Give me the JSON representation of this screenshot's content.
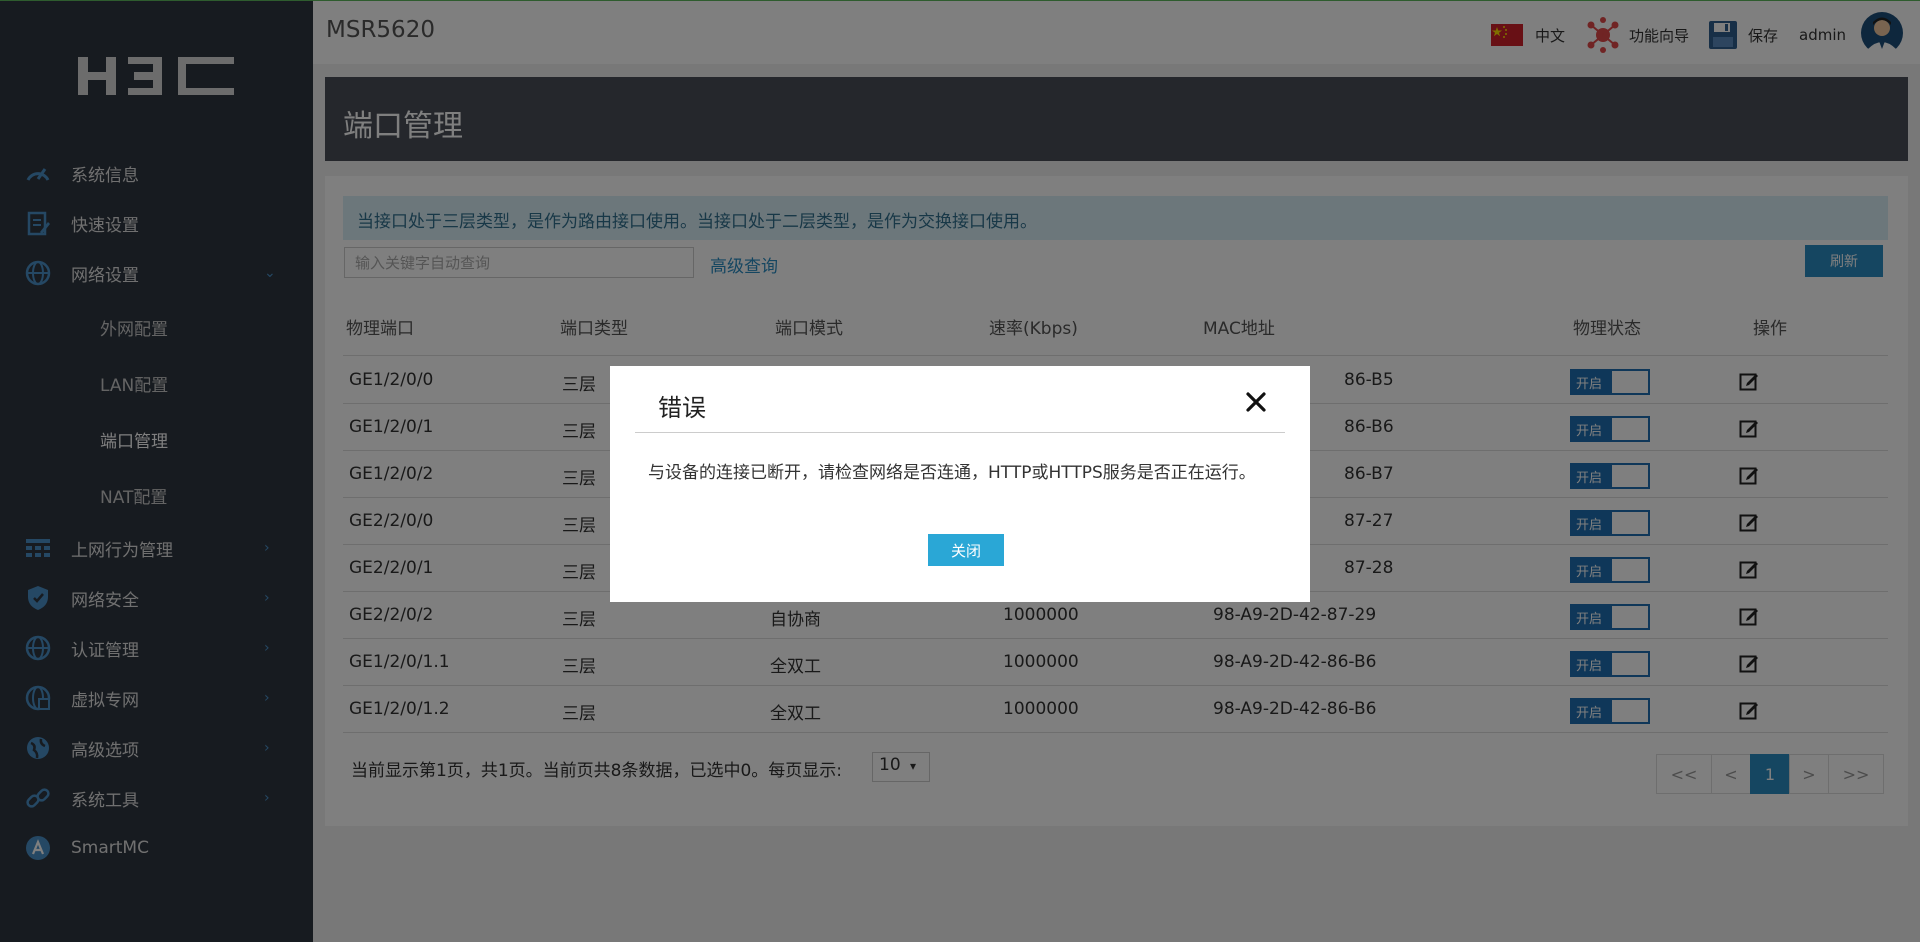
{
  "header": {
    "device_name": "MSR5620",
    "language_label": "中文",
    "wizard_label": "功能向导",
    "save_label": "保存",
    "user_name": "admin"
  },
  "sidebar": {
    "logo_text": "H3C",
    "items": [
      {
        "label": "系统信息",
        "icon": "speedometer-icon",
        "expanded": false
      },
      {
        "label": "快速设置",
        "icon": "clipboard-icon",
        "expanded": false
      },
      {
        "label": "网络设置",
        "icon": "globe-icon",
        "expanded": true,
        "chevron": "⌄"
      },
      {
        "label": "上网行为管理",
        "icon": "grid-icon",
        "chevron": "›"
      },
      {
        "label": "网络安全",
        "icon": "shield-icon",
        "chevron": "›"
      },
      {
        "label": "认证管理",
        "icon": "globe-icon",
        "chevron": "›"
      },
      {
        "label": "虚拟专网",
        "icon": "network-globe-icon",
        "chevron": "›"
      },
      {
        "label": "高级选项",
        "icon": "globe-slash-icon",
        "chevron": "›"
      },
      {
        "label": "系统工具",
        "icon": "link-icon",
        "chevron": "›"
      },
      {
        "label": "SmartMC",
        "icon": "smartmc-icon"
      }
    ],
    "subitems": [
      {
        "label": "外网配置"
      },
      {
        "label": "LAN配置"
      },
      {
        "label": "端口管理",
        "active": true
      },
      {
        "label": "NAT配置"
      }
    ]
  },
  "page": {
    "title": "端口管理",
    "info_tip": "当接口处于三层类型，是作为路由接口使用。当接口处于二层类型，是作为交换接口使用。",
    "search_placeholder": "输入关键字自动查询",
    "advanced_search": "高级查询",
    "refresh": "刷新"
  },
  "table": {
    "columns": [
      "物理端口",
      "端口类型",
      "端口模式",
      "速率(Kbps)",
      "MAC地址",
      "物理状态",
      "操作"
    ],
    "rows": [
      {
        "port": "GE1/2/0/0",
        "type": "三层",
        "mode": "",
        "speed": "",
        "mac": "86-B5",
        "status": "开启"
      },
      {
        "port": "GE1/2/0/1",
        "type": "三层",
        "mode": "",
        "speed": "",
        "mac": "86-B6",
        "status": "开启"
      },
      {
        "port": "GE1/2/0/2",
        "type": "三层",
        "mode": "",
        "speed": "",
        "mac": "86-B7",
        "status": "开启"
      },
      {
        "port": "GE2/2/0/0",
        "type": "三层",
        "mode": "",
        "speed": "",
        "mac": "87-27",
        "status": "开启"
      },
      {
        "port": "GE2/2/0/1",
        "type": "三层",
        "mode": "",
        "speed": "",
        "mac": "87-28",
        "status": "开启"
      },
      {
        "port": "GE2/2/0/2",
        "type": "三层",
        "mode": "自协商",
        "speed": "1000000",
        "mac": "98-A9-2D-42-87-29",
        "status": "开启"
      },
      {
        "port": "GE1/2/0/1.1",
        "type": "三层",
        "mode": "全双工",
        "speed": "1000000",
        "mac": "98-A9-2D-42-86-B6",
        "status": "开启"
      },
      {
        "port": "GE1/2/0/1.2",
        "type": "三层",
        "mode": "全双工",
        "speed": "1000000",
        "mac": "98-A9-2D-42-86-B6",
        "status": "开启"
      }
    ]
  },
  "pager": {
    "summary": "当前显示第1页，共1页。当前页共8条数据，已选中0。每页显示:",
    "page_size": "10",
    "buttons": [
      "<<",
      "<",
      "1",
      ">",
      ">>"
    ],
    "current": "1"
  },
  "modal": {
    "title": "错误",
    "message": "与设备的连接已断开，请检查网络是否连通，HTTP或HTTPS服务是否正在运行。",
    "close_button": "关闭"
  },
  "colors": {
    "sidebar_bg": "#2f3640",
    "accent": "#2a8dc3",
    "toggle": "#1f6fb2",
    "modal_button": "#2aa7d6"
  }
}
